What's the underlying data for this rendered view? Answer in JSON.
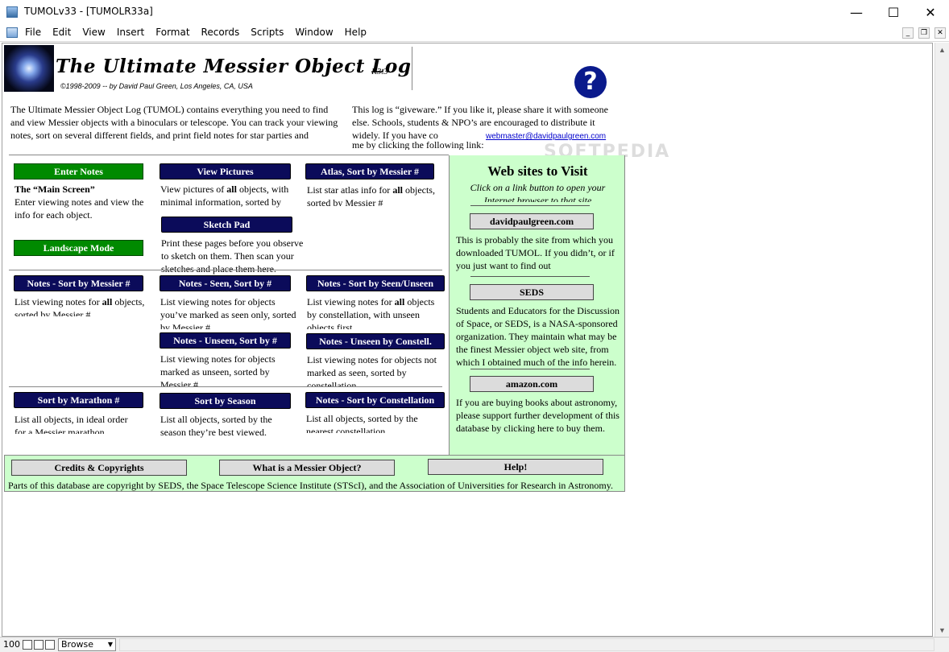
{
  "window": {
    "title": "TUMOLv33 - [TUMOLR33a]",
    "controls": {
      "minimize": "—",
      "maximize": "☐",
      "close": "✕"
    }
  },
  "menu": [
    "File",
    "Edit",
    "View",
    "Insert",
    "Format",
    "Records",
    "Scripts",
    "Window",
    "Help"
  ],
  "mdi": {
    "minimize": "_",
    "restore": "❐",
    "close": "✕"
  },
  "header": {
    "title": "The Ultimate Messier Object Log",
    "version": "R3.3",
    "copyright": "©1998-2009  --  by David Paul Green, Los Angeles, CA, USA",
    "help_icon": "?"
  },
  "intro": {
    "left": "The Ultimate Messier Object Log (TUMOL) contains everything you need to find and view Messier objects with a binoculars or telescope. You can track your viewing notes, sort on several different fields, and print field notes for star parties and",
    "right": "This log is “giveware.” If you like it, please share it with someone else. Schools, students & NPO’s are encouraged to distribute it widely. If you have co",
    "right_tail": "me by clicking the following link:",
    "email": "webmaster@davidpaulgreen.com"
  },
  "watermark": "SOFTPEDIA",
  "buttons": {
    "enter_notes": "Enter Notes",
    "view_pictures": "View Pictures",
    "atlas_messier": "Atlas, Sort by Messier #",
    "sketch_pad": "Sketch Pad",
    "landscape_mode": "Landscape Mode",
    "notes_sort_messier": "Notes - Sort by Messier #",
    "notes_seen_sort": "Notes - Seen, Sort by #",
    "notes_sort_seen_unseen": "Notes - Sort by Seen/Unseen",
    "notes_unseen_sort": "Notes - Unseen, Sort by #",
    "notes_unseen_constell": "Notes - Unseen by Constell.",
    "sort_marathon": "Sort by Marathon #",
    "sort_season": "Sort by Season",
    "notes_sort_constellation": "Notes - Sort by Constellation"
  },
  "descriptions": {
    "main_screen_title": "The “Main Screen”",
    "main_screen": "Enter viewing notes and view the info for each object.",
    "view_pictures_a": "View pictures of ",
    "view_pictures_b": "all",
    "view_pictures_c": " objects, with minimal information, sorted by Messier #",
    "atlas_a": "List star atlas info for ",
    "atlas_b": "all",
    "atlas_c": " objects, sorted by Messier #",
    "sketch_pad": "Print these pages before you observe to sketch on them. Then scan your sketches and place them here.",
    "notes_messier_a": "List viewing notes for ",
    "notes_messier_b": "all",
    "notes_messier_c": " objects, sorted by Messier #",
    "notes_seen": "List viewing notes for objects you’ve marked as seen only, sorted by Messier #",
    "notes_seen_unseen_a": "List  viewing notes for ",
    "notes_seen_unseen_b": "all",
    "notes_seen_unseen_c": " objects by constellation, with unseen objects first",
    "notes_unseen": "List viewing notes for objects marked as unseen, sorted by Messier #",
    "notes_unseen_constell": "List viewing notes for objects not marked as seen, sorted by constellation",
    "marathon": "List all objects, in ideal order  for a Messier marathon",
    "season": "List all objects, sorted by the season they’re best viewed.",
    "constellation": "List all objects, sorted by the nearest  constellation"
  },
  "websites": {
    "title": "Web sites to Visit",
    "subtitle": "Click on a link button to open your Internet browser to that site",
    "site1_label": "davidpaulgreen.com",
    "site1_desc": "This is probably the site from which you downloaded TUMOL. If you didn’t, or if you just want to find out",
    "site2_label": "SEDS",
    "site2_desc": "Students and Educators for the Discussion of Space, or SEDS, is a NASA-sponsored organization. They maintain what may be the finest Messier object web site, from which I obtained much of the info herein.",
    "site3_label": "amazon.com",
    "site3_desc": "If you are buying books about astronomy, please support further development of this database by clicking here to buy them."
  },
  "footer": {
    "credits": "Credits & Copyrights",
    "what_is": "What is a Messier Object?",
    "help": "Help!",
    "note": "Parts of this database are copyright by SEDS, the Space Telescope Science Institute (STScI), and the Association of  Universities for Research in Astronomy."
  },
  "status": {
    "zoom": "100",
    "mode": "Browse"
  }
}
